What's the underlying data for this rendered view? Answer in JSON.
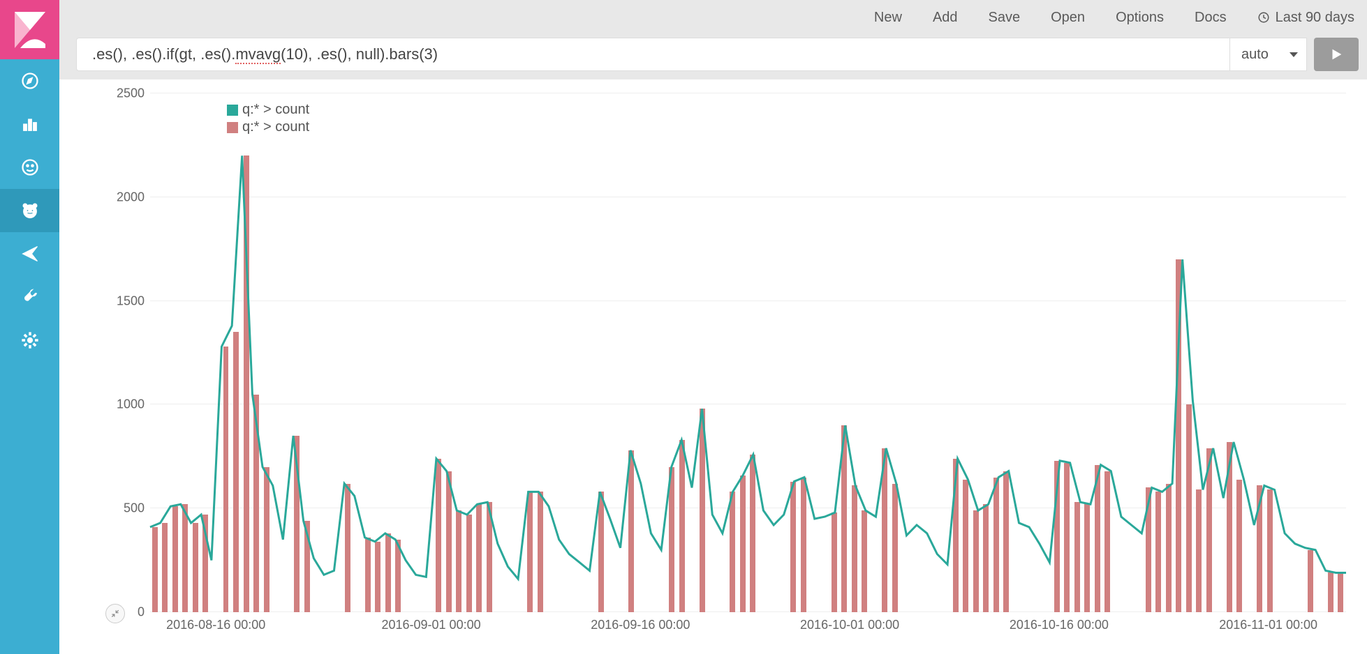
{
  "topbar": {
    "menu": [
      "New",
      "Add",
      "Save",
      "Open",
      "Options",
      "Docs"
    ],
    "time_label": "Last 90 days"
  },
  "query": {
    "expression_prefix": ".es(), .es().if(gt, .es().",
    "expression_misspell": "mvavg",
    "expression_suffix": "(10), .es(), null).bars(3)",
    "interval": "auto"
  },
  "legend": {
    "series1": {
      "label": "q:* > count",
      "color": "#2aa89a"
    },
    "series2": {
      "label": "q:* > count",
      "color": "#d08080"
    }
  },
  "chart_data": {
    "type": "line+bar",
    "ylim": [
      0,
      2500
    ],
    "yticks": [
      0,
      500,
      1000,
      1500,
      2000,
      2500
    ],
    "xticks": [
      "2016-08-16 00:00",
      "2016-09-01 00:00",
      "2016-09-16 00:00",
      "2016-10-01 00:00",
      "2016-10-16 00:00",
      "2016-11-01 00:00"
    ],
    "xtick_positions": [
      0.055,
      0.235,
      0.41,
      0.585,
      0.76,
      0.935
    ],
    "series": [
      {
        "name": "q:* > count (line)",
        "type": "line",
        "color": "#2aa89a",
        "values": [
          410,
          430,
          510,
          520,
          430,
          470,
          250,
          1280,
          1380,
          2200,
          1050,
          700,
          610,
          350,
          850,
          440,
          260,
          180,
          200,
          620,
          560,
          360,
          340,
          380,
          350,
          250,
          180,
          170,
          740,
          680,
          490,
          470,
          520,
          530,
          330,
          220,
          160,
          580,
          580,
          510,
          350,
          280,
          240,
          200,
          580,
          450,
          310,
          780,
          620,
          380,
          300,
          700,
          830,
          600,
          980,
          470,
          380,
          580,
          660,
          760,
          490,
          420,
          470,
          630,
          650,
          450,
          460,
          480,
          900,
          610,
          490,
          460,
          790,
          620,
          370,
          420,
          380,
          280,
          230,
          740,
          640,
          490,
          520,
          650,
          680,
          430,
          410,
          330,
          240,
          730,
          720,
          530,
          520,
          710,
          680,
          460,
          420,
          380,
          600,
          580,
          620,
          1700,
          1020,
          590,
          790,
          550,
          820,
          640,
          420,
          610,
          590,
          380,
          330,
          310,
          300,
          200,
          190,
          190
        ]
      },
      {
        "name": "q:* > count (bars)",
        "type": "bar",
        "color": "#d08080",
        "values": [
          410,
          430,
          510,
          520,
          430,
          470,
          null,
          1280,
          1350,
          2200,
          1050,
          700,
          null,
          null,
          850,
          440,
          null,
          null,
          null,
          620,
          null,
          360,
          340,
          380,
          350,
          null,
          null,
          null,
          740,
          680,
          490,
          470,
          520,
          530,
          null,
          null,
          null,
          580,
          580,
          null,
          null,
          null,
          null,
          null,
          580,
          null,
          null,
          780,
          null,
          null,
          null,
          700,
          830,
          null,
          980,
          null,
          null,
          580,
          660,
          760,
          null,
          null,
          null,
          630,
          650,
          null,
          null,
          480,
          900,
          610,
          490,
          null,
          790,
          620,
          null,
          null,
          null,
          null,
          null,
          740,
          640,
          490,
          520,
          650,
          680,
          null,
          null,
          null,
          null,
          730,
          720,
          530,
          520,
          710,
          680,
          null,
          null,
          null,
          600,
          580,
          620,
          1700,
          1000,
          590,
          790,
          null,
          820,
          640,
          null,
          610,
          590,
          null,
          null,
          null,
          300,
          null,
          190,
          190
        ]
      }
    ]
  },
  "colors": {
    "sidebar": "#3caed2",
    "sidebar_active": "#2f99ba",
    "logo": "#e8478b",
    "line": "#2aa89a",
    "bar": "#d08080"
  }
}
